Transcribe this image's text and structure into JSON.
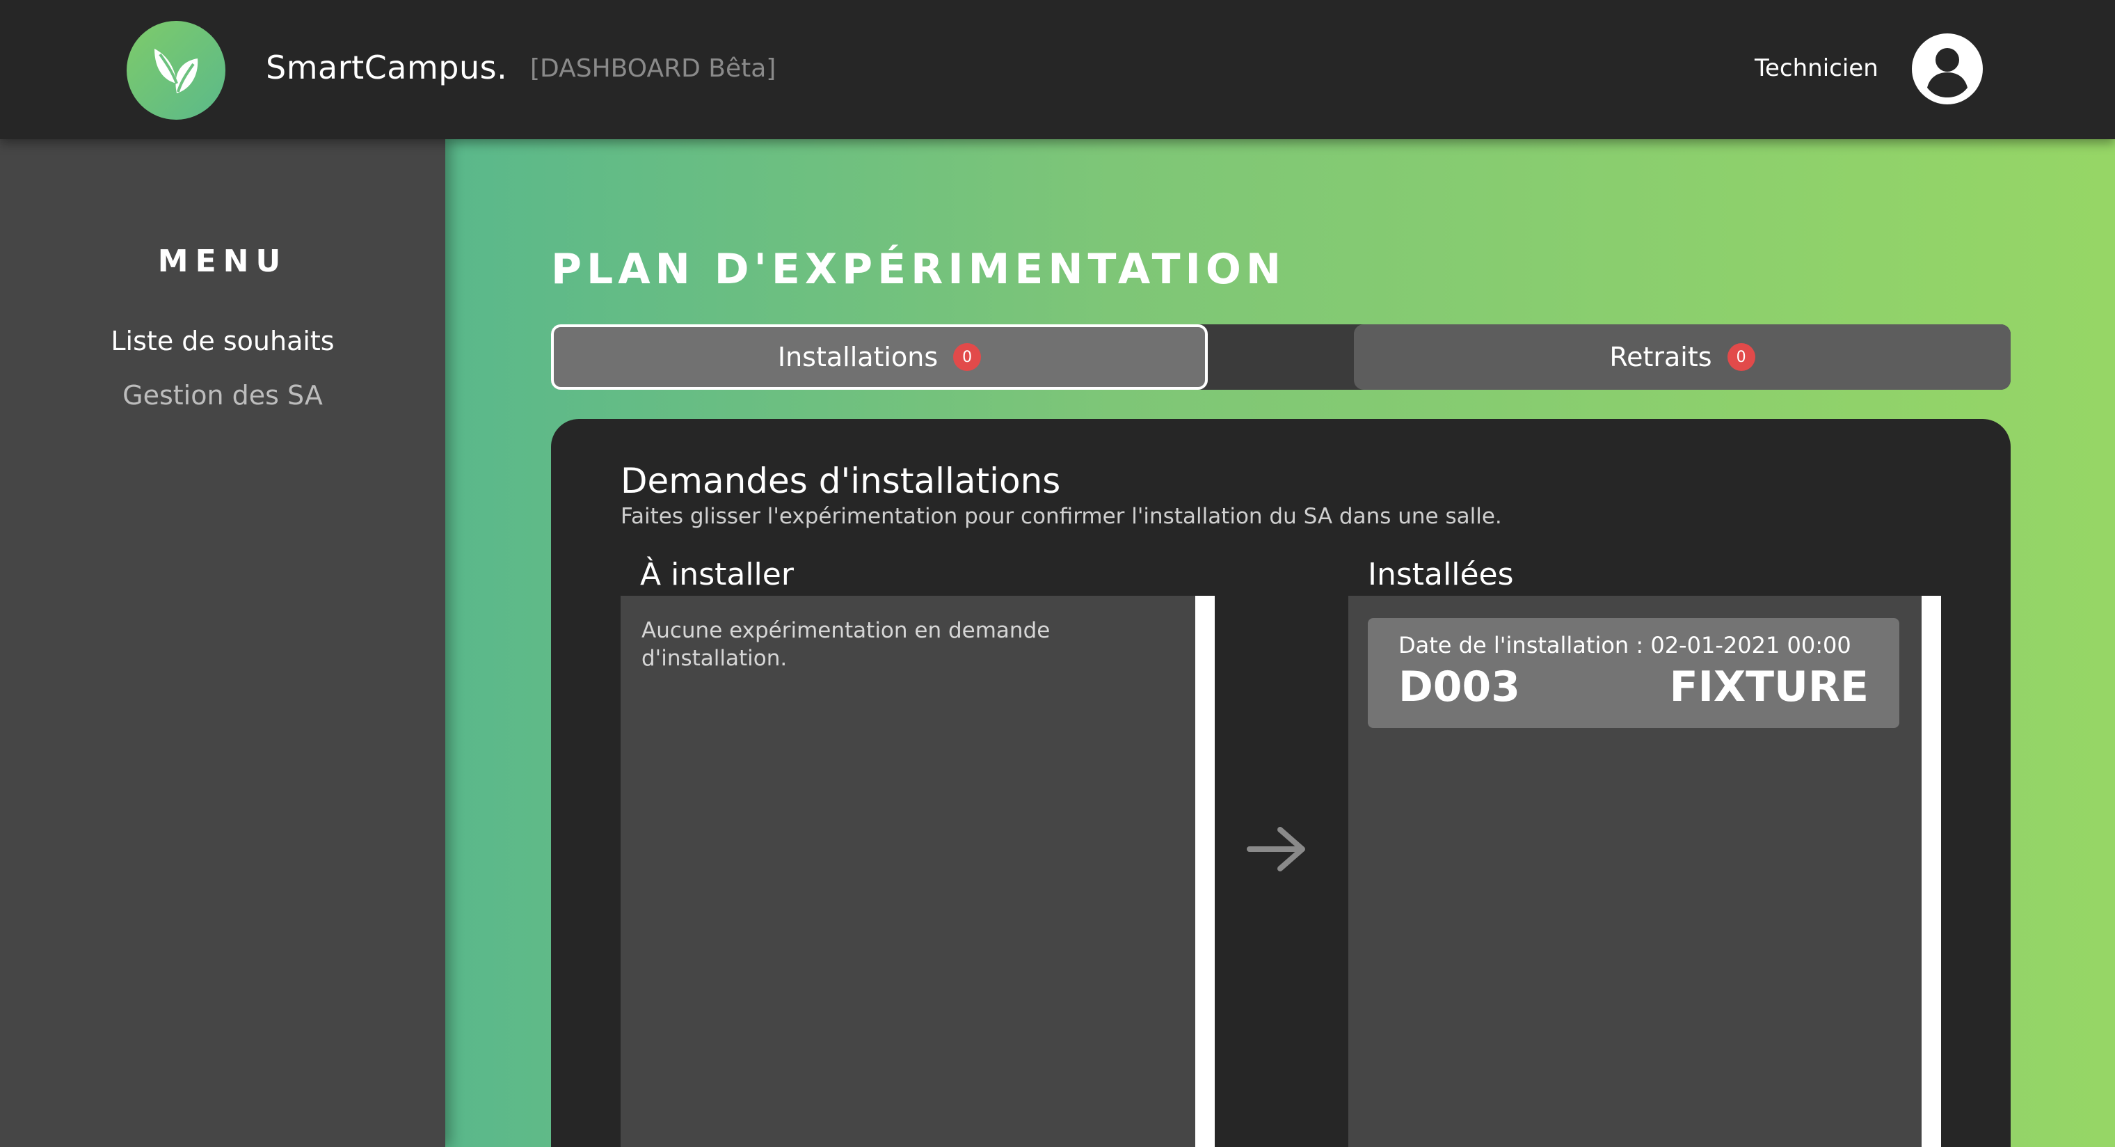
{
  "header": {
    "app_name": "SmartCampus.",
    "app_tag": "[DASHBOARD Bêta]",
    "user_role": "Technicien",
    "logo_icon": "leaf-icon",
    "avatar_icon": "user-circle-icon"
  },
  "sidebar": {
    "title": "MENU",
    "items": [
      {
        "label": "Liste de souhaits",
        "active": true
      },
      {
        "label": "Gestion des SA",
        "active": false
      }
    ]
  },
  "main": {
    "title": "PLAN D'EXPÉRIMENTATION",
    "tabs": [
      {
        "label": "Installations",
        "count": "0",
        "selected": true
      },
      {
        "label": "Retraits",
        "count": "0",
        "selected": false
      }
    ],
    "panel": {
      "title": "Demandes d'installations",
      "subtitle": "Faites glisser l'expérimentation pour confirmer l'installation du SA dans une salle.",
      "columns": {
        "to_install": {
          "title": "À installer",
          "empty_text": "Aucune expérimentation en demande d'installation."
        },
        "installed": {
          "title": "Installées",
          "items": [
            {
              "date_label": "Date de l'installation : 02-01-2021 00:00",
              "room": "D003",
              "type": "FIXTURE"
            }
          ]
        }
      },
      "arrow_icon": "arrow-right-icon"
    }
  },
  "colors": {
    "header_bg": "#262626",
    "sidebar_bg": "#464646",
    "gradient_start": "#5ab88b",
    "gradient_end": "#96d666",
    "badge": "#e24a4a"
  }
}
